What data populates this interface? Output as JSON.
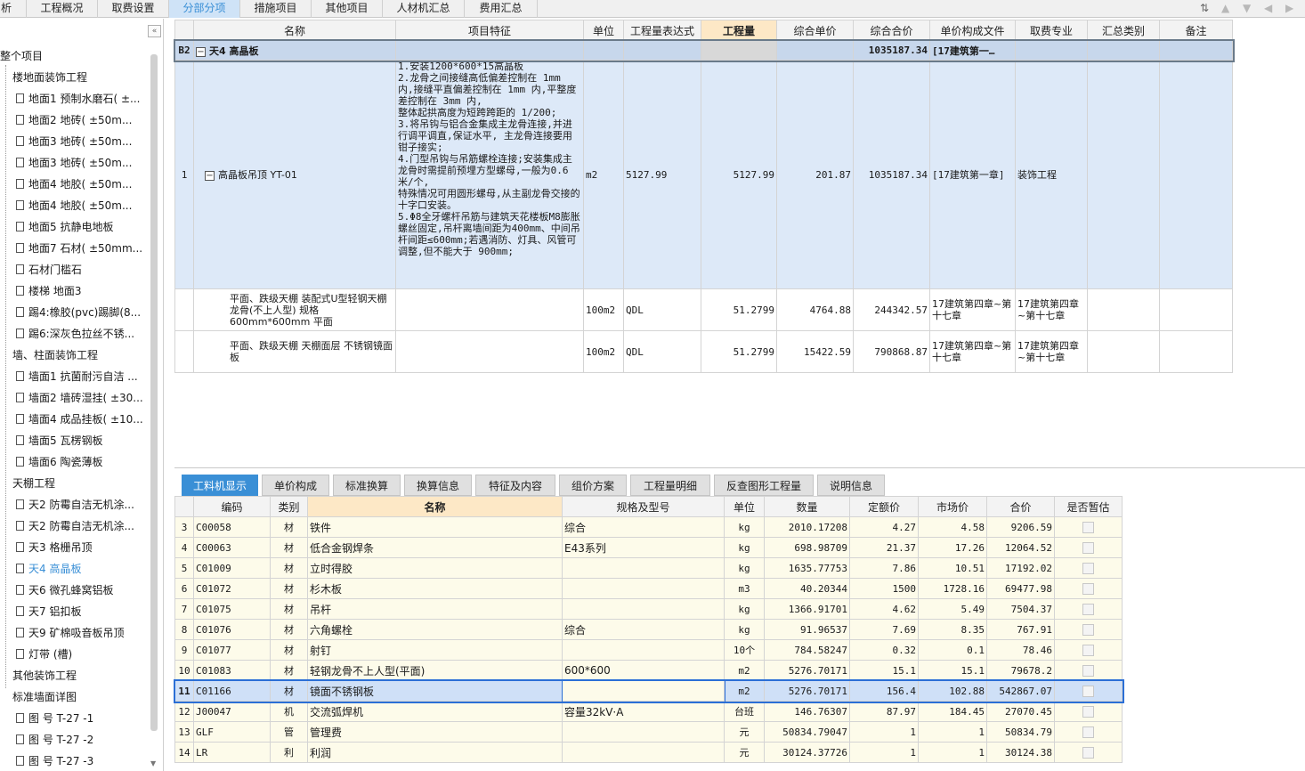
{
  "top_tabs": [
    {
      "label": "析",
      "active": false
    },
    {
      "label": "工程概况",
      "active": false
    },
    {
      "label": "取费设置",
      "active": false
    },
    {
      "label": "分部分项",
      "active": true
    },
    {
      "label": "措施项目",
      "active": false
    },
    {
      "label": "其他项目",
      "active": false
    },
    {
      "label": "人材机汇总",
      "active": false
    },
    {
      "label": "费用汇总",
      "active": false
    }
  ],
  "tree": {
    "collapse_icon": "double-chevron-left-icon",
    "items": [
      {
        "label": "整个项目",
        "level": 0,
        "doc": false
      },
      {
        "label": "楼地面装饰工程",
        "level": 1,
        "doc": false
      },
      {
        "label": "地面1 预制水磨石( ±...",
        "level": 2,
        "doc": true
      },
      {
        "label": "地面2  地砖( ±50m...",
        "level": 2,
        "doc": true
      },
      {
        "label": "地面3  地砖( ±50m...",
        "level": 2,
        "doc": true
      },
      {
        "label": "地面3  地砖( ±50m...",
        "level": 2,
        "doc": true
      },
      {
        "label": "地面4  地胶( ±50m...",
        "level": 2,
        "doc": true
      },
      {
        "label": "地面4  地胶( ±50m...",
        "level": 2,
        "doc": true
      },
      {
        "label": "地面5  抗静电地板",
        "level": 2,
        "doc": true
      },
      {
        "label": "地面7 石材( ±50mm...",
        "level": 2,
        "doc": true
      },
      {
        "label": "石材门槛石",
        "level": 2,
        "doc": true
      },
      {
        "label": "楼梯 地面3",
        "level": 2,
        "doc": true
      },
      {
        "label": "踢4:橡胶(pvc)踢脚(8...",
        "level": 2,
        "doc": true
      },
      {
        "label": "踢6:深灰色拉丝不锈...",
        "level": 2,
        "doc": true
      },
      {
        "label": "墙、柱面装饰工程",
        "level": 1,
        "doc": false
      },
      {
        "label": "墙面1 抗菌耐污自洁 ...",
        "level": 2,
        "doc": true
      },
      {
        "label": "墙面2 墙砖湿挂( ±30...",
        "level": 2,
        "doc": true
      },
      {
        "label": "墙面4 成品挂板( ±10...",
        "level": 2,
        "doc": true
      },
      {
        "label": "墙面5 瓦楞钢板",
        "level": 2,
        "doc": true
      },
      {
        "label": "墙面6 陶瓷薄板",
        "level": 2,
        "doc": true
      },
      {
        "label": "天棚工程",
        "level": 1,
        "doc": false
      },
      {
        "label": "天2 防霉自洁无机涂...",
        "level": 2,
        "doc": true
      },
      {
        "label": "天2 防霉自洁无机涂...",
        "level": 2,
        "doc": true
      },
      {
        "label": "天3 格栅吊顶",
        "level": 2,
        "doc": true
      },
      {
        "label": "天4 高晶板",
        "level": 2,
        "doc": true,
        "selected": true
      },
      {
        "label": "天6 微孔蜂窝铝板",
        "level": 2,
        "doc": true
      },
      {
        "label": "天7 铝扣板",
        "level": 2,
        "doc": true
      },
      {
        "label": "天9 矿棉吸音板吊顶",
        "level": 2,
        "doc": true
      },
      {
        "label": "灯带 (槽)",
        "level": 2,
        "doc": true
      },
      {
        "label": "其他装饰工程",
        "level": 1,
        "doc": false
      },
      {
        "label": "标准墙面详图",
        "level": 1,
        "doc": false
      },
      {
        "label": "图 号 T-27  -1",
        "level": 2,
        "doc": true
      },
      {
        "label": "图 号 T-27  -2",
        "level": 2,
        "doc": true
      },
      {
        "label": "图 号 T-27  -3",
        "level": 2,
        "doc": true
      }
    ]
  },
  "main_grid": {
    "headers": [
      "",
      "名称",
      "项目特征",
      "单位",
      "工程量表达式",
      "工程量",
      "综合单价",
      "综合合价",
      "单价构成文件",
      "取费专业",
      "汇总类别",
      "备注"
    ],
    "highlight_header": "工程量",
    "rows": [
      {
        "type": "section",
        "cells": [
          "B2",
          "天4 高晶板",
          "",
          "",
          "",
          "",
          "",
          "1035187.34",
          "[17建筑第一…",
          "",
          "",
          ""
        ]
      },
      {
        "type": "item",
        "cells": [
          "1",
          "高晶板吊顶 YT-01",
          "1.安装1200*600*15高晶板\n2.龙骨之间接缝高低偏差控制在 1mm 内,接缝平直偏差控制在 1mm 内,平整度差控制在 3mm 内,\n整体起拱高度为短跨跨距的 1/200;\n3.将吊钩与铝合金集成主龙骨连接,并进行调平调直,保证水平, 主龙骨连接要用钳子接实;\n4.门型吊钩与吊筋螺栓连接;安装集成主龙骨时需提前预埋方型螺母,一般为0.6 米/个,\n特殊情况可用圆形螺母,从主副龙骨交接的十字口安装。\n5.Φ8全牙螺杆吊筋与建筑天花楼板M8膨胀螺丝固定,吊杆离墙间距为400mm、中间吊杆间距≤600mm;若遇消防、灯具、风管可调整,但不能大于 900mm;",
          "m2",
          "5127.99",
          "5127.99",
          "201.87",
          "1035187.34",
          "[17建筑第一章]",
          "装饰工程",
          "",
          ""
        ]
      },
      {
        "type": "sub",
        "cells": [
          "",
          "平面、跌级天棚 装配式U型轻钢天棚龙骨(不上人型) 规格600mm*600mm 平面",
          "",
          "100m2",
          "QDL",
          "51.2799",
          "4764.88",
          "244342.57",
          "17建筑第四章~第十七章",
          "17建筑第四章~第十七章",
          "",
          ""
        ]
      },
      {
        "type": "sub",
        "cells": [
          "",
          "平面、跌级天棚 天棚面层 不锈钢镜面板",
          "",
          "100m2",
          "QDL",
          "51.2799",
          "15422.59",
          "790868.87",
          "17建筑第四章~第十七章",
          "17建筑第四章~第十七章",
          "",
          ""
        ]
      }
    ]
  },
  "bottom_tabs": [
    {
      "label": "工料机显示",
      "active": true
    },
    {
      "label": "单价构成",
      "active": false
    },
    {
      "label": "标准换算",
      "active": false
    },
    {
      "label": "换算信息",
      "active": false
    },
    {
      "label": "特征及内容",
      "active": false
    },
    {
      "label": "组价方案",
      "active": false
    },
    {
      "label": "工程量明细",
      "active": false
    },
    {
      "label": "反查图形工程量",
      "active": false
    },
    {
      "label": "说明信息",
      "active": false
    }
  ],
  "resource_grid": {
    "headers": [
      "",
      "编码",
      "类别",
      "名称",
      "规格及型号",
      "单位",
      "数量",
      "定额价",
      "市场价",
      "合价",
      "是否暂估"
    ],
    "highlight_header": "名称",
    "rows": [
      [
        "3",
        "C00058",
        "材",
        "铁件",
        "综合",
        "kg",
        "2010.17208",
        "4.27",
        "4.58",
        "9206.59"
      ],
      [
        "4",
        "C00063",
        "材",
        "低合金钢焊条",
        "E43系列",
        "kg",
        "698.98709",
        "21.37",
        "17.26",
        "12064.52"
      ],
      [
        "5",
        "C01009",
        "材",
        "立时得胶",
        "",
        "kg",
        "1635.77753",
        "7.86",
        "10.51",
        "17192.02"
      ],
      [
        "6",
        "C01072",
        "材",
        "杉木板",
        "",
        "m3",
        "40.20344",
        "1500",
        "1728.16",
        "69477.98"
      ],
      [
        "7",
        "C01075",
        "材",
        "吊杆",
        "",
        "kg",
        "1366.91701",
        "4.62",
        "5.49",
        "7504.37"
      ],
      [
        "8",
        "C01076",
        "材",
        "六角螺栓",
        "综合",
        "kg",
        "91.96537",
        "7.69",
        "8.35",
        "767.91"
      ],
      [
        "9",
        "C01077",
        "材",
        "射钉",
        "",
        "10个",
        "784.58247",
        "0.32",
        "0.1",
        "78.46"
      ],
      [
        "10",
        "C01083",
        "材",
        "轻钢龙骨不上人型(平面)",
        "600*600",
        "m2",
        "5276.70171",
        "15.1",
        "15.1",
        "79678.2"
      ],
      [
        "11",
        "C01166",
        "材",
        "镜面不锈钢板",
        "",
        "m2",
        "5276.70171",
        "156.4",
        "102.88",
        "542867.07"
      ],
      [
        "12",
        "J00047",
        "机",
        "交流弧焊机",
        "容量32kV·A",
        "台班",
        "146.76307",
        "87.97",
        "184.45",
        "27070.45"
      ],
      [
        "13",
        "GLF",
        "管",
        "管理费",
        "",
        "元",
        "50834.79047",
        "1",
        "1",
        "50834.79"
      ],
      [
        "14",
        "LR",
        "利",
        "利润",
        "",
        "元",
        "30124.37726",
        "1",
        "1",
        "30124.38"
      ]
    ],
    "selected_row": 8
  }
}
